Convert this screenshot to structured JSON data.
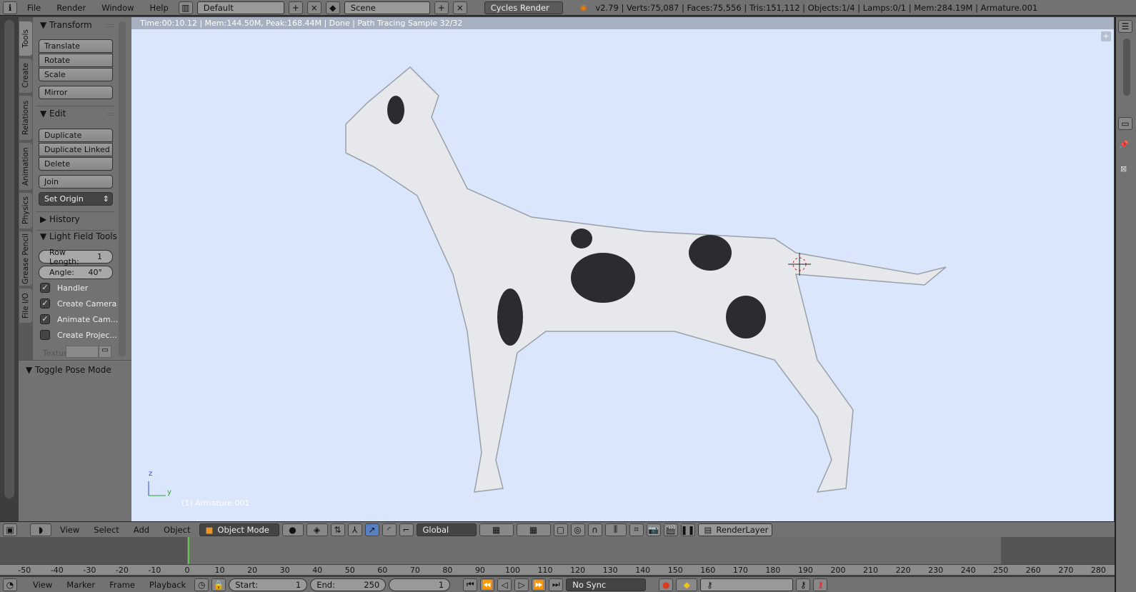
{
  "topbar": {
    "menus": [
      "File",
      "Render",
      "Window",
      "Help"
    ],
    "layout": "Default",
    "scene": "Scene",
    "engine": "Cycles Render",
    "stats": "v2.79 | Verts:75,087 | Faces:75,556 | Tris:151,112 | Objects:1/4 | Lamps:0/1 | Mem:284.19M | Armature.001"
  },
  "tool_tabs": [
    "Tools",
    "Create",
    "Relations",
    "Animation",
    "Physics",
    "Grease Pencil",
    "File I/O"
  ],
  "tool_panel": {
    "transform": {
      "title": "Transform",
      "buttons": [
        "Translate",
        "Rotate",
        "Scale",
        "Mirror"
      ]
    },
    "edit": {
      "title": "Edit",
      "buttons": [
        "Duplicate",
        "Duplicate Linked",
        "Delete",
        "Join"
      ],
      "set_origin": "Set Origin"
    },
    "history": {
      "title": "History"
    },
    "light_field": {
      "title": "Light Field Tools",
      "row_length_label": "Row Length:",
      "row_length": "1",
      "angle_label": "Angle:",
      "angle": "40°",
      "checkboxes": [
        {
          "label": "Handler",
          "checked": true
        },
        {
          "label": "Create Camera",
          "checked": true
        },
        {
          "label": "Animate Cam...",
          "checked": true
        },
        {
          "label": "Create Projec...",
          "checked": false
        }
      ],
      "texture_label": "Textur"
    },
    "toggle_pose": {
      "title": "Toggle Pose Mode"
    }
  },
  "viewport": {
    "render_info": "Time:00:10.12 | Mem:144.50M, Peak:168.44M | Done | Path Tracing Sample 32/32",
    "object_label": "(1) Armature.001",
    "axis_z": "z",
    "axis_y": "y"
  },
  "header3d": {
    "menus": [
      "View",
      "Select",
      "Add",
      "Object"
    ],
    "mode": "Object Mode",
    "orientation": "Global",
    "render_layer": "RenderLayer"
  },
  "timeline": {
    "ticks": [
      -50,
      -40,
      -30,
      -20,
      -10,
      0,
      10,
      20,
      30,
      40,
      50,
      60,
      70,
      80,
      90,
      100,
      110,
      120,
      130,
      140,
      150,
      160,
      170,
      180,
      190,
      200,
      210,
      220,
      230,
      240,
      250,
      260,
      270,
      280
    ],
    "current_frame": 1
  },
  "bottombar": {
    "menus": [
      "View",
      "Marker",
      "Frame",
      "Playback"
    ],
    "start_label": "Start:",
    "start": "1",
    "end_label": "End:",
    "end": "250",
    "frame": "1",
    "sync": "No Sync"
  }
}
